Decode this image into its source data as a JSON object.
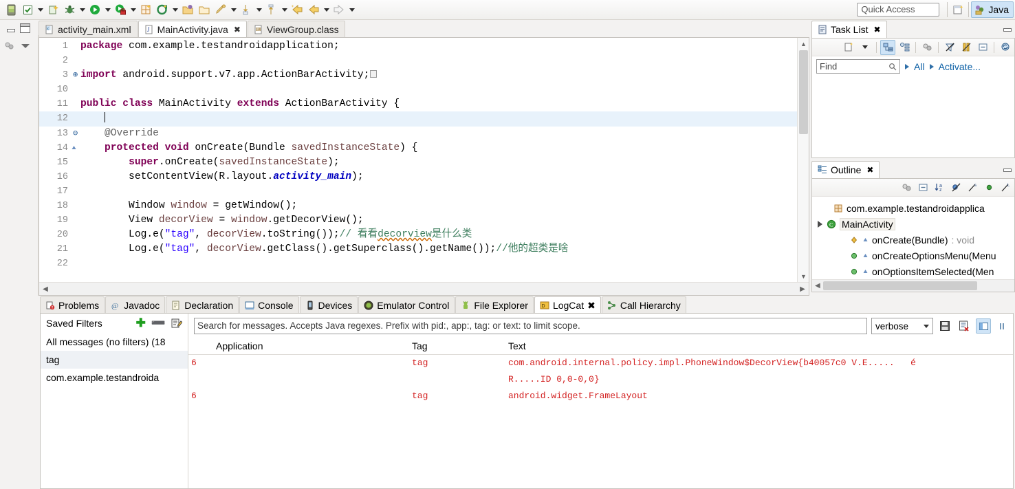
{
  "toolbar": {
    "quick_access_placeholder": "Quick Access",
    "perspective_label": "Java",
    "icons": [
      "android-sdk-manager-icon",
      "save-icon",
      "new-wizard-icon",
      "debug-icon",
      "run-icon",
      "run-external-tools-icon",
      "new-android-project-icon",
      "open-type-icon",
      "open-package-icon",
      "open-resource-icon",
      "search-icon",
      "marker-next-icon",
      "marker-prev-icon",
      "back-icon",
      "forward-icon"
    ]
  },
  "editor": {
    "tabs": [
      {
        "label": "activity_main.xml",
        "icon": "xml-file-icon",
        "active": false,
        "closable": false
      },
      {
        "label": "MainActivity.java",
        "icon": "java-file-icon",
        "active": true,
        "closable": true
      },
      {
        "label": "ViewGroup.class",
        "icon": "class-file-icon",
        "active": false,
        "closable": false
      }
    ],
    "close_glyph": "✖",
    "lines": [
      {
        "num": "1",
        "fold": "",
        "highlight": false,
        "segs": [
          {
            "t": "package ",
            "c": "k"
          },
          {
            "t": "com.example.testandroidapplication;",
            "c": ""
          }
        ]
      },
      {
        "num": "2",
        "fold": "",
        "highlight": false,
        "segs": []
      },
      {
        "num": "3",
        "fold": "plus",
        "highlight": false,
        "segs": [
          {
            "t": "import ",
            "c": "k"
          },
          {
            "t": "android.support.v7.app.ActionBarActivity;",
            "c": ""
          },
          {
            "t": "▢",
            "c": "foldbox"
          }
        ]
      },
      {
        "num": "10",
        "fold": "",
        "highlight": false,
        "segs": []
      },
      {
        "num": "11",
        "fold": "",
        "highlight": false,
        "segs": [
          {
            "t": "public class ",
            "c": "k"
          },
          {
            "t": "MainActivity ",
            "c": ""
          },
          {
            "t": "extends ",
            "c": "k"
          },
          {
            "t": "ActionBarActivity {",
            "c": ""
          }
        ]
      },
      {
        "num": "12",
        "fold": "",
        "highlight": true,
        "segs": [
          {
            "t": "    ",
            "c": ""
          },
          {
            "t": "|",
            "c": "caret"
          }
        ]
      },
      {
        "num": "13",
        "fold": "minus",
        "highlight": false,
        "segs": [
          {
            "t": "    ",
            "c": ""
          },
          {
            "t": "@Override",
            "c": "ann"
          }
        ]
      },
      {
        "num": "14",
        "fold": "tri",
        "highlight": false,
        "segs": [
          {
            "t": "    ",
            "c": ""
          },
          {
            "t": "protected void ",
            "c": "k"
          },
          {
            "t": "onCreate(Bundle ",
            "c": ""
          },
          {
            "t": "savedInstanceState",
            "c": "prm"
          },
          {
            "t": ") {",
            "c": ""
          }
        ]
      },
      {
        "num": "15",
        "fold": "",
        "highlight": false,
        "segs": [
          {
            "t": "        ",
            "c": ""
          },
          {
            "t": "super",
            "c": "k"
          },
          {
            "t": ".onCreate(",
            "c": ""
          },
          {
            "t": "savedInstanceState",
            "c": "prm"
          },
          {
            "t": ");",
            "c": ""
          }
        ]
      },
      {
        "num": "16",
        "fold": "",
        "highlight": false,
        "segs": [
          {
            "t": "        setContentView(R.layout.",
            "c": ""
          },
          {
            "t": "activity_main",
            "c": "fld"
          },
          {
            "t": ");",
            "c": ""
          }
        ]
      },
      {
        "num": "17",
        "fold": "",
        "highlight": false,
        "segs": []
      },
      {
        "num": "18",
        "fold": "",
        "highlight": false,
        "segs": [
          {
            "t": "        Window ",
            "c": ""
          },
          {
            "t": "window",
            "c": "prm"
          },
          {
            "t": " = getWindow();",
            "c": ""
          }
        ]
      },
      {
        "num": "19",
        "fold": "",
        "highlight": false,
        "segs": [
          {
            "t": "        View ",
            "c": ""
          },
          {
            "t": "decorView",
            "c": "prm"
          },
          {
            "t": " = ",
            "c": ""
          },
          {
            "t": "window",
            "c": "prm"
          },
          {
            "t": ".getDecorView();",
            "c": ""
          }
        ]
      },
      {
        "num": "20",
        "fold": "",
        "highlight": false,
        "segs": [
          {
            "t": "        Log.e(",
            "c": ""
          },
          {
            "t": "\"tag\"",
            "c": "str"
          },
          {
            "t": ", ",
            "c": ""
          },
          {
            "t": "decorView",
            "c": "prm"
          },
          {
            "t": ".toString());",
            "c": ""
          },
          {
            "t": "// 看看",
            "c": "cmt"
          },
          {
            "t": "decorview",
            "c": "cmtsq"
          },
          {
            "t": "是什么类",
            "c": "cmt"
          }
        ]
      },
      {
        "num": "21",
        "fold": "",
        "highlight": false,
        "segs": [
          {
            "t": "        Log.e(",
            "c": ""
          },
          {
            "t": "\"tag\"",
            "c": "str"
          },
          {
            "t": ", ",
            "c": ""
          },
          {
            "t": "decorView",
            "c": "prm"
          },
          {
            "t": ".getClass().getSuperclass().getName());",
            "c": ""
          },
          {
            "t": "//他的超类是啥",
            "c": "cmt"
          }
        ]
      },
      {
        "num": "22",
        "fold": "",
        "highlight": false,
        "segs": []
      }
    ]
  },
  "task_list": {
    "tab_label": "Task List",
    "tab_icon": "task-list-icon",
    "close_glyph": "✖",
    "find_placeholder": "Find",
    "link_all": "All",
    "link_activate": "Activate...",
    "toolbar_icons": [
      "new-task-icon",
      "menu-arrow-icon",
      "categorized-view-icon",
      "scheduled-view-icon",
      "focus-icon",
      "collapse-all-icon",
      "filter-icon",
      "minimize-icon",
      "synchronize-icon"
    ]
  },
  "outline": {
    "tab_label": "Outline",
    "tab_icon": "outline-icon",
    "close_glyph": "✖",
    "toolbar_icons": [
      "focus-icon",
      "collapse-all-icon",
      "sort-az-icon",
      "hide-fields-icon",
      "hide-static-icon",
      "hide-nonpublic-icon",
      "hide-local-icon"
    ],
    "items": [
      {
        "label": "com.example.testandroidapplica",
        "icon": "package-icon",
        "indent": 1,
        "expander": false,
        "selected": false,
        "ret": ""
      },
      {
        "label": "MainActivity",
        "icon": "class-icon",
        "indent": 0,
        "expander": true,
        "selected": true,
        "ret": ""
      },
      {
        "label": "onCreate(Bundle)",
        "icon": "method-protected-icon",
        "indent": 2,
        "expander": false,
        "selected": false,
        "ret": " : void"
      },
      {
        "label": "onCreateOptionsMenu(Menu",
        "icon": "method-public-icon",
        "indent": 2,
        "expander": false,
        "selected": false,
        "ret": ""
      },
      {
        "label": "onOptionsItemSelected(Men",
        "icon": "method-public-icon",
        "indent": 2,
        "expander": false,
        "selected": false,
        "ret": ""
      }
    ]
  },
  "bottom_panel": {
    "tabs": [
      {
        "label": "Problems",
        "icon": "problems-icon",
        "active": false,
        "closable": false
      },
      {
        "label": "Javadoc",
        "icon": "javadoc-icon",
        "active": false,
        "closable": false
      },
      {
        "label": "Declaration",
        "icon": "declaration-icon",
        "active": false,
        "closable": false
      },
      {
        "label": "Console",
        "icon": "console-icon",
        "active": false,
        "closable": false
      },
      {
        "label": "Devices",
        "icon": "devices-icon",
        "active": false,
        "closable": false
      },
      {
        "label": "Emulator Control",
        "icon": "emulator-control-icon",
        "active": false,
        "closable": false
      },
      {
        "label": "File Explorer",
        "icon": "file-explorer-icon",
        "active": false,
        "closable": false
      },
      {
        "label": "LogCat",
        "icon": "logcat-icon",
        "active": true,
        "closable": true
      },
      {
        "label": "Call Hierarchy",
        "icon": "call-hierarchy-icon",
        "active": false,
        "closable": false
      }
    ],
    "close_glyph": "✖"
  },
  "logcat": {
    "filters_title": "Saved Filters",
    "add_glyph": "✚",
    "remove_glyph": "➖",
    "edit_icon": "edit-filter-icon",
    "filters": [
      {
        "label": "All messages (no filters) (18",
        "selected": false
      },
      {
        "label": "tag",
        "selected": true
      },
      {
        "label": "com.example.testandroida",
        "selected": false
      }
    ],
    "search_placeholder": "Search for messages. Accepts Java regexes. Prefix with pid:, app:, tag: or text: to limit scope.",
    "level": "verbose",
    "toolbar_icons": [
      "save-log-icon",
      "clear-log-icon",
      "display-view-icon",
      "scroll-lock-icon"
    ],
    "columns": [
      "",
      "Application",
      "Tag",
      "Text"
    ],
    "rows": [
      {
        "level": "6",
        "application": "",
        "tag": "tag",
        "text_lines": [
          "com.android.internal.policy.impl.PhoneWindow$DecorView{b40057c0 V.E.....   é",
          "R.....ID 0,0-0,0}"
        ]
      },
      {
        "level": "6",
        "application": "",
        "tag": "tag",
        "text_lines": [
          "android.widget.FrameLayout"
        ]
      }
    ]
  }
}
